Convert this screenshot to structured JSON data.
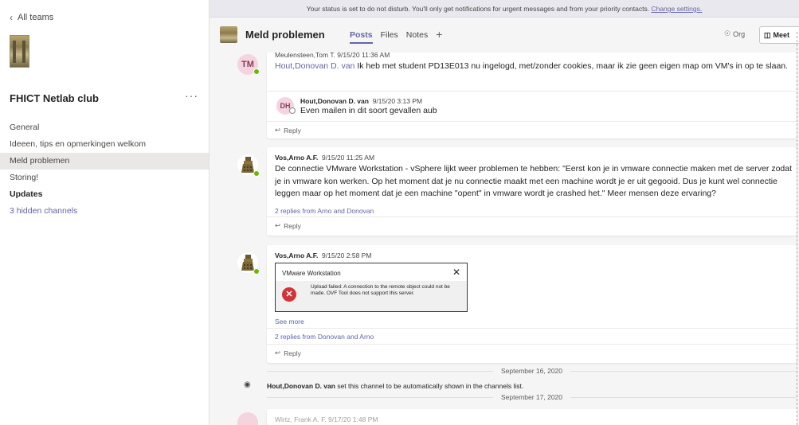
{
  "banner": {
    "text": "Your status is set to do not disturb. You'll only get notifications for urgent messages and from your priority contacts.",
    "link": "Change settings."
  },
  "sidebar": {
    "back_label": "All teams",
    "team_name": "FHICT Netlab club",
    "more": "···",
    "channels": [
      {
        "label": "General"
      },
      {
        "label": "Ideeen, tips en opmerkingen welkom"
      },
      {
        "label": "Meld problemen"
      },
      {
        "label": "Storing!"
      },
      {
        "label": "Updates"
      },
      {
        "label": "3 hidden channels"
      }
    ]
  },
  "header": {
    "title": "Meld problemen",
    "tabs": [
      {
        "label": "Posts"
      },
      {
        "label": "Files"
      },
      {
        "label": "Notes"
      }
    ],
    "add": "+",
    "org_label": "Org",
    "meet_label": "Meet"
  },
  "feed": {
    "post1": {
      "initials": "TM",
      "meta": "Meulensteen,Tom T.  9/15/20 11:36 AM",
      "mention": "Hout,Donovan D. van",
      "text": " Ik heb met student PD13E013 nu ingelogd, met/zonder cookies, maar ik zie geen eigen map om VM's in op te slaan.",
      "reply_initials": "DH",
      "reply_author": "Hout,Donovan D. van",
      "reply_time": "9/15/20 3:13 PM",
      "reply_text": "Even mailen in dit soort gevallen aub",
      "reply_label": "Reply"
    },
    "post2": {
      "author": "Vos,Arno A.F.",
      "time": "9/15/20 11:25 AM",
      "text": "De connectie VMware Workstation - vSphere lijkt weer problemen te hebben: \"Eerst kon je in vmware connectie maken met de server zodat je in vmware kon werken. Op het moment dat je nu connectie maakt met een machine wordt je er uit gegooid. Dus je kunt wel connectie leggen maar op het moment dat je een machine \"opent\" in vmware wordt je crashed het.\"  Meer mensen deze ervaring?",
      "replies": "2 replies from Arno and Donovan",
      "reply_label": "Reply"
    },
    "post3": {
      "author": "Vos,Arno A.F.",
      "time": "9/15/20 2:58 PM",
      "dialog_title": "VMware Workstation",
      "dialog_close": "✕",
      "dialog_text": "Upload failed: A connection to the remote object could not be made. OVF Tool does not support this server.",
      "see_more": "See more",
      "replies": "2 replies from Donovan and Arno",
      "reply_label": "Reply"
    },
    "date1": "September 16, 2020",
    "event": {
      "author": "Hout,Donovan D. van",
      "text": " set this channel to be automatically shown in the channels list."
    },
    "date2": "September 17, 2020",
    "partial": "Wirtz, Frank A. F. 9/17/20 1:48 PM"
  },
  "colors": {
    "accent": "#6264a7",
    "presence_available": "#6bb700",
    "error": "#d13438"
  }
}
